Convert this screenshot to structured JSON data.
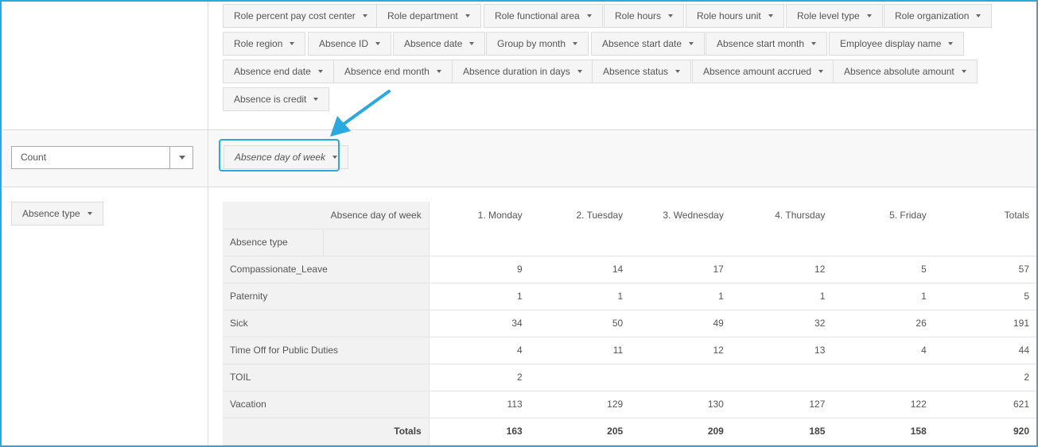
{
  "field_chips": [
    {
      "label": "Role percent pay cost center"
    },
    {
      "label": "Role department"
    },
    {
      "label": "Role functional area"
    },
    {
      "label": "Role hours"
    },
    {
      "label": "Role hours unit"
    },
    {
      "label": "Role level type"
    },
    {
      "label": "Role organization"
    },
    {
      "label": "Role region"
    },
    {
      "label": "Absence ID"
    },
    {
      "label": "Absence date"
    },
    {
      "label": "Group by month"
    },
    {
      "label": "Absence start date"
    },
    {
      "label": "Absence start month"
    },
    {
      "label": "Employee display name"
    },
    {
      "label": "Absence end date"
    },
    {
      "label": "Absence end month"
    },
    {
      "label": "Absence duration in days"
    },
    {
      "label": "Absence status"
    },
    {
      "label": "Absence amount accrued"
    },
    {
      "label": "Absence absolute amount"
    },
    {
      "label": "Absence is credit"
    }
  ],
  "aggregator": {
    "value": "Count"
  },
  "column_field": {
    "label": "Absence day of week"
  },
  "row_field": {
    "label": "Absence type"
  },
  "table": {
    "col_field_header": "Absence day of week",
    "row_field_header": "Absence type",
    "columns": [
      "1. Monday",
      "2. Tuesday",
      "3. Wednesday",
      "4. Thursday",
      "5. Friday",
      "Totals"
    ],
    "rows": [
      {
        "label": "Compassionate_Leave",
        "values": [
          "9",
          "14",
          "17",
          "12",
          "5",
          "57"
        ]
      },
      {
        "label": "Paternity",
        "values": [
          "1",
          "1",
          "1",
          "1",
          "1",
          "5"
        ]
      },
      {
        "label": "Sick",
        "values": [
          "34",
          "50",
          "49",
          "32",
          "26",
          "191"
        ]
      },
      {
        "label": "Time Off for Public Duties",
        "values": [
          "4",
          "11",
          "12",
          "13",
          "4",
          "44"
        ]
      },
      {
        "label": "TOIL",
        "values": [
          "2",
          "",
          "",
          "",
          "",
          "2"
        ]
      },
      {
        "label": "Vacation",
        "values": [
          "113",
          "129",
          "130",
          "127",
          "122",
          "621"
        ]
      }
    ],
    "totals_label": "Totals",
    "totals": [
      "163",
      "205",
      "209",
      "185",
      "158",
      "920"
    ]
  },
  "colors": {
    "accent": "#29a9e0",
    "chip_bg": "#f5f5f5",
    "border": "#dddddd"
  }
}
